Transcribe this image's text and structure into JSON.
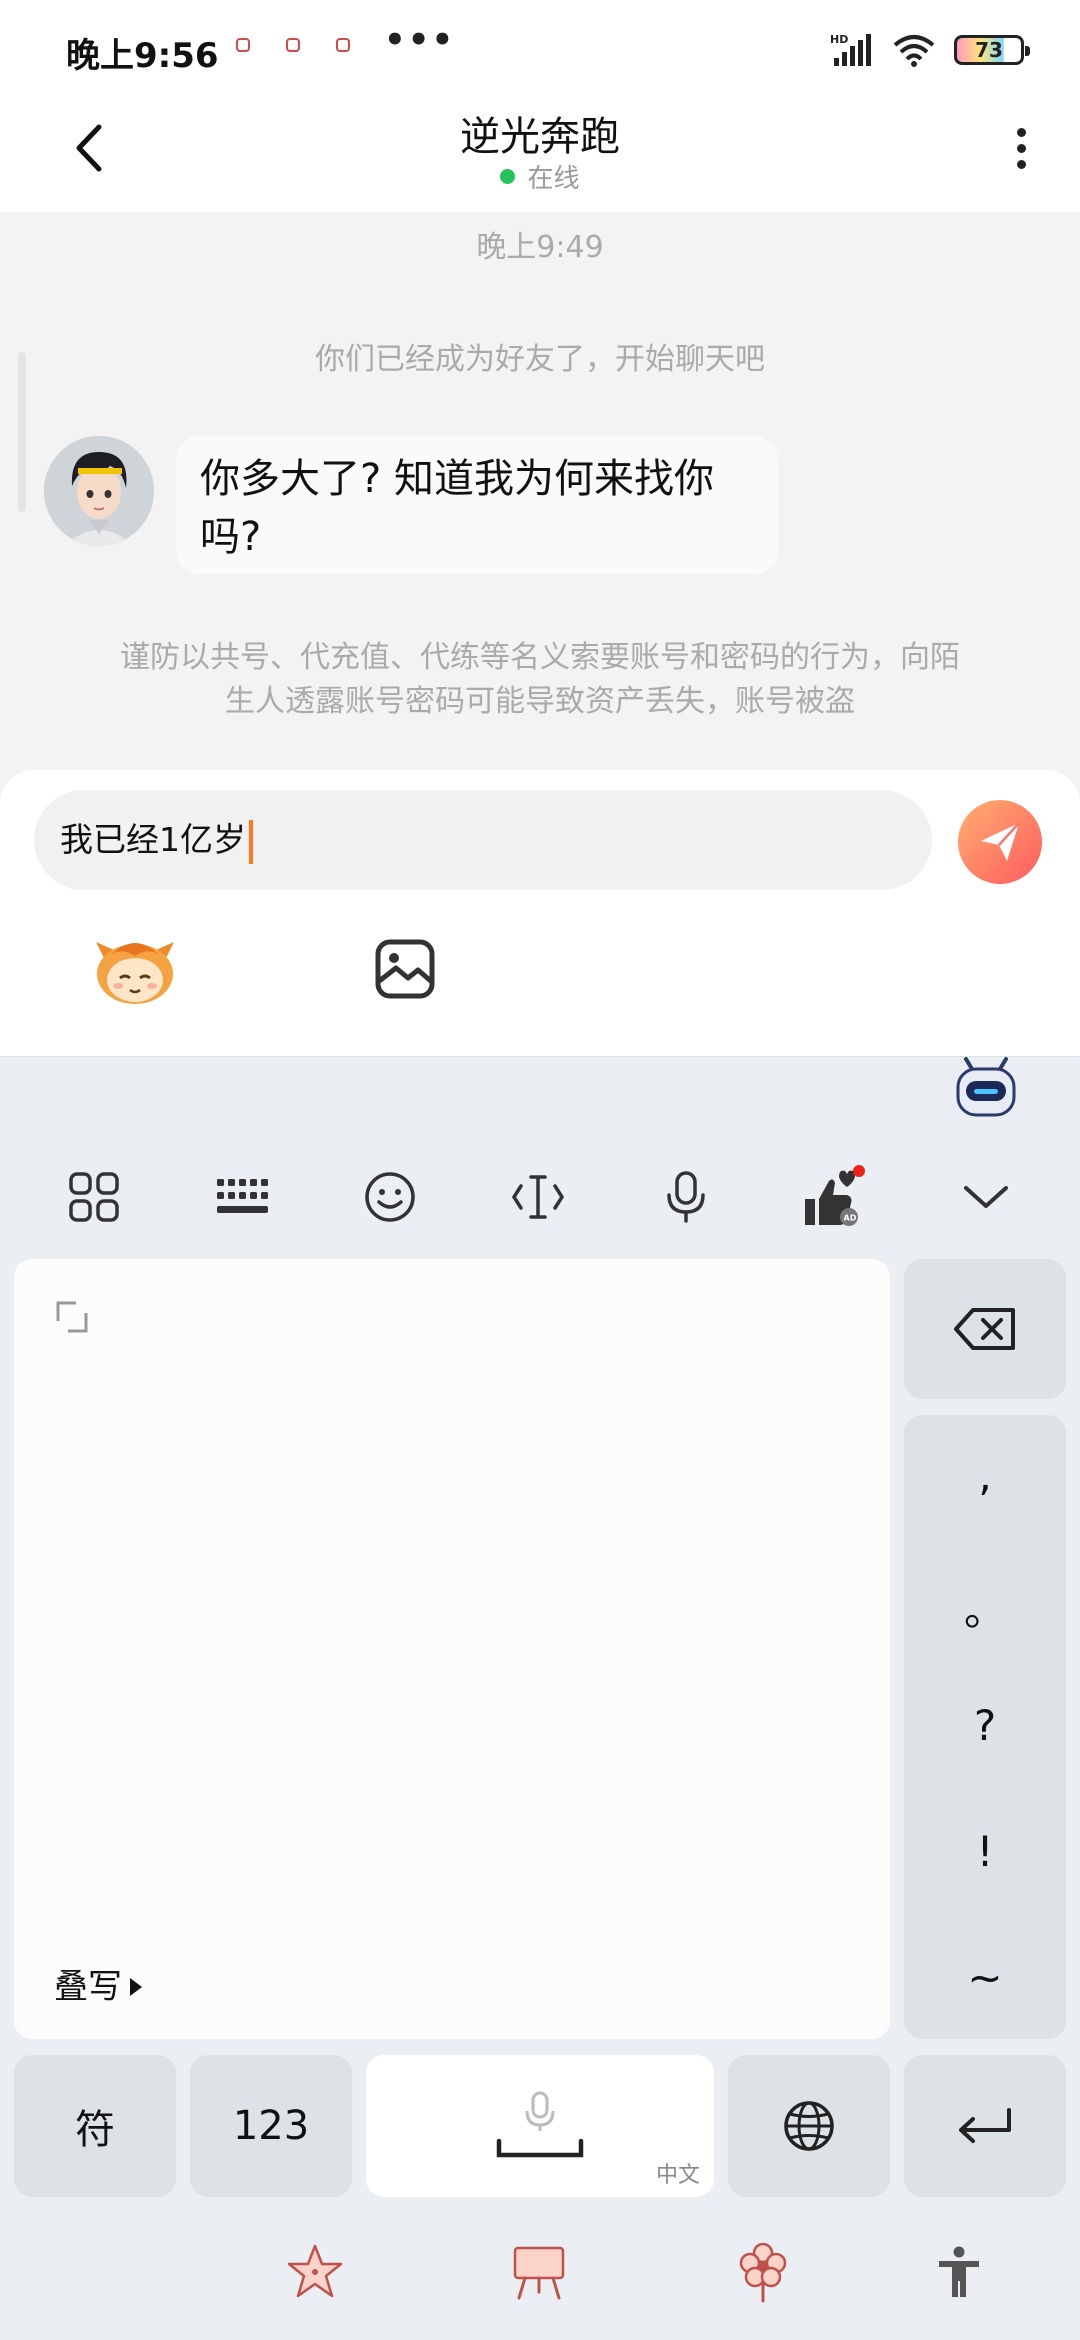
{
  "status_bar": {
    "time": "晚上9:56",
    "dots": "•••",
    "network": "HD",
    "battery": "73"
  },
  "header": {
    "title": "逆光奔跑",
    "status": "在线"
  },
  "chat": {
    "time_label": "晚上9:49",
    "system_message": "你们已经成为好友了，开始聊天吧",
    "incoming_message_line1": "你多大了? 知道我为何来找你",
    "incoming_message_line2": "吗?",
    "warning_line1": "谨防以共号、代充值、代练等名义索要账号和密码的行为，向陌",
    "warning_line2": "生人透露账号密码可能导致资产丢失，账号被盗"
  },
  "input": {
    "value": "我已经1亿岁"
  },
  "keyboard": {
    "handwriting_label": "叠写",
    "punctuation": [
      ",",
      "。",
      "?",
      "!",
      "~"
    ],
    "keys": {
      "symbol": "符",
      "numbers": "123",
      "space_sub": "中文"
    }
  },
  "colors": {
    "accent": "#ff7a1a",
    "online": "#25c25a",
    "send_gradient_start": "#ffb070",
    "send_gradient_end": "#ff5a5f"
  }
}
